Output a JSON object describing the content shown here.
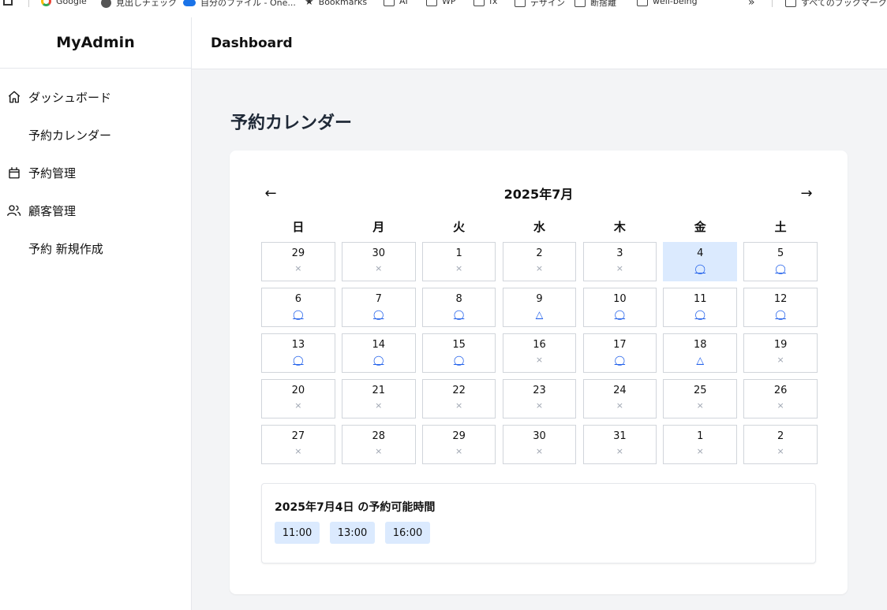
{
  "bookmarks": [
    "Google",
    "見出しチェック",
    "自分のファイル - One...",
    "Bookmarks",
    "AI",
    "WP",
    "fx",
    "デザイン",
    "断捨離",
    "well-being",
    "»",
    "すべてのブックマーク"
  ],
  "brand": "MyAdmin",
  "header": {
    "title": "Dashboard"
  },
  "sidebar": {
    "items": [
      {
        "label": "ダッシュボード",
        "icon": "home-icon"
      },
      {
        "label": "予約カレンダー",
        "icon": ""
      },
      {
        "label": "予約管理",
        "icon": "calendar-icon"
      },
      {
        "label": "顧客管理",
        "icon": "users-icon"
      },
      {
        "label": "予約 新規作成",
        "icon": ""
      }
    ]
  },
  "page": {
    "title": "予約カレンダー"
  },
  "calendar": {
    "prev_label": "←",
    "next_label": "→",
    "month_label": "2025年7月",
    "weekdays": [
      "日",
      "月",
      "火",
      "水",
      "木",
      "金",
      "土"
    ],
    "days": [
      {
        "d": "29",
        "s": "×"
      },
      {
        "d": "30",
        "s": "×"
      },
      {
        "d": "1",
        "s": "×"
      },
      {
        "d": "2",
        "s": "×"
      },
      {
        "d": "3",
        "s": "×"
      },
      {
        "d": "4",
        "s": "◯",
        "selected": true
      },
      {
        "d": "5",
        "s": "◯"
      },
      {
        "d": "6",
        "s": "◯"
      },
      {
        "d": "7",
        "s": "◯"
      },
      {
        "d": "8",
        "s": "◯"
      },
      {
        "d": "9",
        "s": "△"
      },
      {
        "d": "10",
        "s": "◯"
      },
      {
        "d": "11",
        "s": "◯"
      },
      {
        "d": "12",
        "s": "◯"
      },
      {
        "d": "13",
        "s": "◯"
      },
      {
        "d": "14",
        "s": "◯"
      },
      {
        "d": "15",
        "s": "◯"
      },
      {
        "d": "16",
        "s": "×"
      },
      {
        "d": "17",
        "s": "◯"
      },
      {
        "d": "18",
        "s": "△"
      },
      {
        "d": "19",
        "s": "×"
      },
      {
        "d": "20",
        "s": "×"
      },
      {
        "d": "21",
        "s": "×"
      },
      {
        "d": "22",
        "s": "×"
      },
      {
        "d": "23",
        "s": "×"
      },
      {
        "d": "24",
        "s": "×"
      },
      {
        "d": "25",
        "s": "×"
      },
      {
        "d": "26",
        "s": "×"
      },
      {
        "d": "27",
        "s": "×"
      },
      {
        "d": "28",
        "s": "×"
      },
      {
        "d": "29",
        "s": "×"
      },
      {
        "d": "30",
        "s": "×"
      },
      {
        "d": "31",
        "s": "×"
      },
      {
        "d": "1",
        "s": "×"
      },
      {
        "d": "2",
        "s": "×"
      }
    ]
  },
  "slots": {
    "title": "2025年7月4日 の予約可能時間",
    "times": [
      "11:00",
      "13:00",
      "16:00"
    ]
  },
  "colors": {
    "accent": "#2563eb",
    "selected_bg": "#dbeafe",
    "main_bg": "#f3f4f6"
  }
}
